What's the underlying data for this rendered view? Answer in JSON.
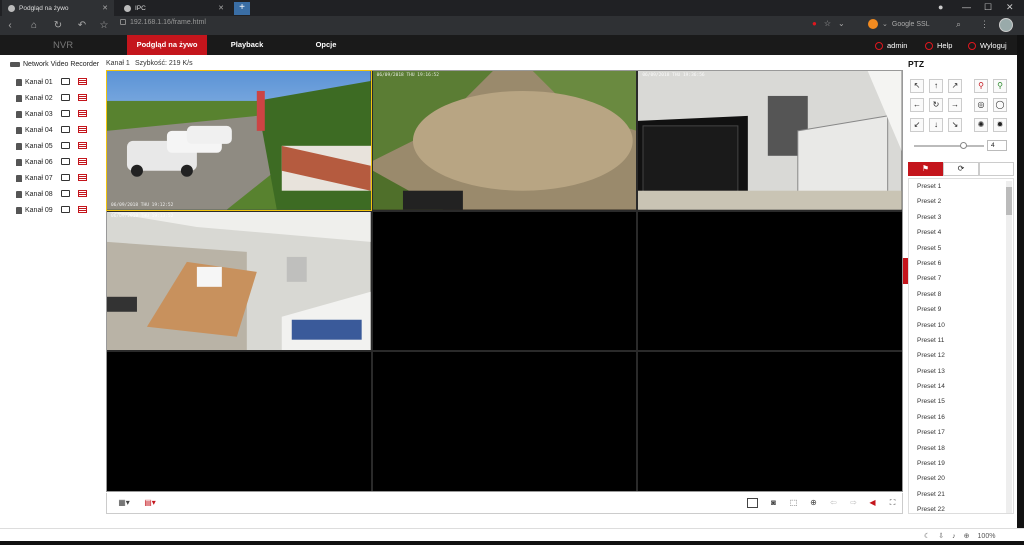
{
  "browser": {
    "tabs": [
      {
        "title": "Podgląd na żywo"
      },
      {
        "title": "IPC"
      }
    ],
    "new_tab": "+",
    "url": "192.168.1.16/frame.html",
    "search_engine": "Google SSL"
  },
  "app": {
    "logo": "NVR",
    "menu": [
      {
        "label": "Podgląd na żywo",
        "active": true
      },
      {
        "label": "Playback",
        "active": false
      },
      {
        "label": "Opcje",
        "active": false
      }
    ],
    "user": "admin",
    "help": "Help",
    "logout": "Wyloguj"
  },
  "sidebar": {
    "root": "Network Video Recorder",
    "channels": [
      {
        "label": "Kanał 01"
      },
      {
        "label": "Kanał 02"
      },
      {
        "label": "Kanał 03"
      },
      {
        "label": "Kanał 04"
      },
      {
        "label": "Kanał 05"
      },
      {
        "label": "Kanał 06"
      },
      {
        "label": "Kanał 07"
      },
      {
        "label": "Kanał 08"
      },
      {
        "label": "Kanał 09"
      }
    ]
  },
  "info": {
    "channel": "Kanał 1",
    "speed": "Szybkość: 219 K/s"
  },
  "video": {
    "osd": [
      "06/09/2018 THU 19:12:52",
      "06/09/2018 THU 19:16:52",
      "06/09/2018 THU 19:36:56",
      "06/09/2018 THU 19:13:52"
    ]
  },
  "ptz": {
    "title": "PTZ",
    "speed": "4",
    "presets": [
      "Preset 1",
      "Preset 2",
      "Preset 3",
      "Preset 4",
      "Preset 5",
      "Preset 6",
      "Preset 7",
      "Preset 8",
      "Preset 9",
      "Preset 10",
      "Preset 11",
      "Preset 12",
      "Preset 13",
      "Preset 14",
      "Preset 15",
      "Preset 16",
      "Preset 17",
      "Preset 18",
      "Preset 19",
      "Preset 20",
      "Preset 21",
      "Preset 22"
    ]
  },
  "status": {
    "zoom": "100%"
  },
  "colors": {
    "accent": "#c4151c",
    "header_bg": "#1a1a1a"
  }
}
